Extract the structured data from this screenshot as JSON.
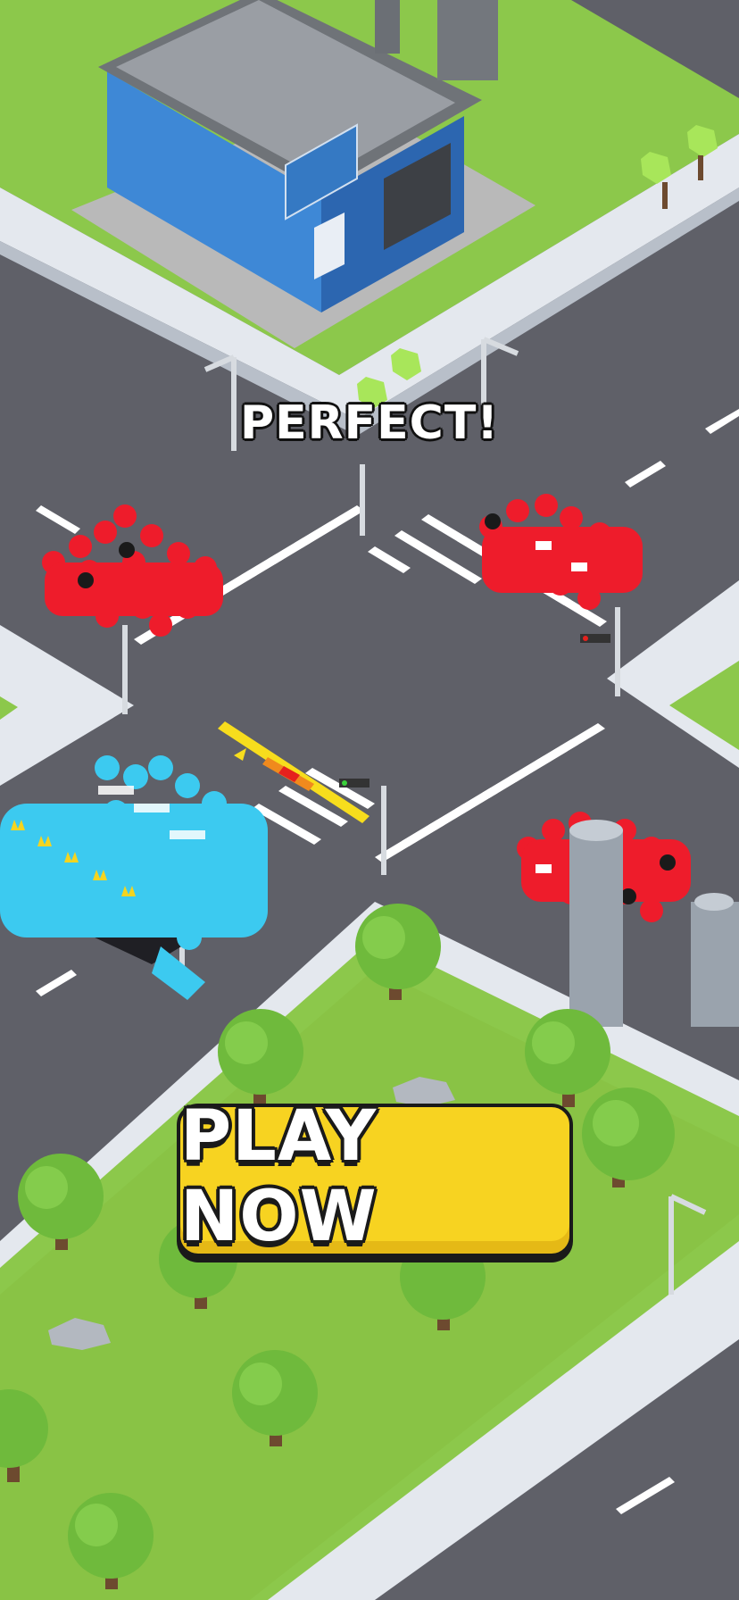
{
  "feedback": {
    "text": "PERFECT!"
  },
  "cta": {
    "label": "PLAY NOW"
  },
  "colors": {
    "road": "#5f6068",
    "grass": "#8cc84b",
    "sidewalk": "#e4e8ee",
    "building": "#3e88d6",
    "player_crowd": "#3ccaf0",
    "enemy_crowd": "#ee1c2b",
    "button": "#f7d321"
  },
  "scene": {
    "icons": [
      "building-icon",
      "tree-icon",
      "street-lamp-icon",
      "traffic-light-icon",
      "crowd-icon",
      "crown-icon",
      "chimney-icon",
      "rock-icon"
    ]
  }
}
